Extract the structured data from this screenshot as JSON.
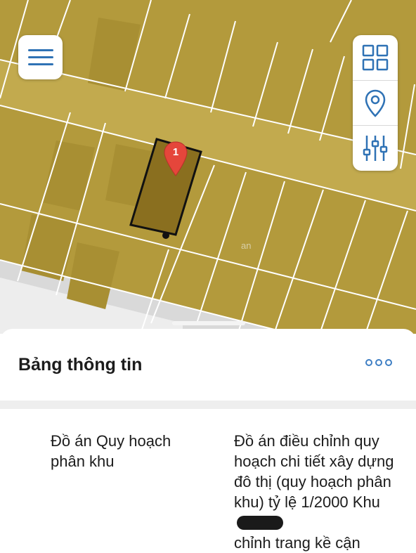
{
  "map": {
    "parcel_marker_label": "1",
    "watermark": "an",
    "colors": {
      "land": "#b39a3c",
      "road": "#c2aa4e",
      "lines": "#ffffff",
      "selected_parcel": "#8a6f1f",
      "marker": "#e5463b"
    }
  },
  "controls": {
    "menu_icon": "hamburger-icon",
    "layers_icon": "grid-icon",
    "location_icon": "location-pin-icon",
    "filter_icon": "sliders-icon",
    "accent_color": "#2f72b5"
  },
  "panel": {
    "title": "Bảng thông tin",
    "more_icon": "more-dots-icon",
    "row": {
      "label": "Đồ án Quy hoạch phân khu",
      "value": "Đồ án điều chỉnh quy hoạch chi tiết xây dựng đô thị (quy hoạch phân khu) tỷ lệ 1/2000 Khu",
      "value_cont": "chỉnh trang kề cận"
    }
  }
}
